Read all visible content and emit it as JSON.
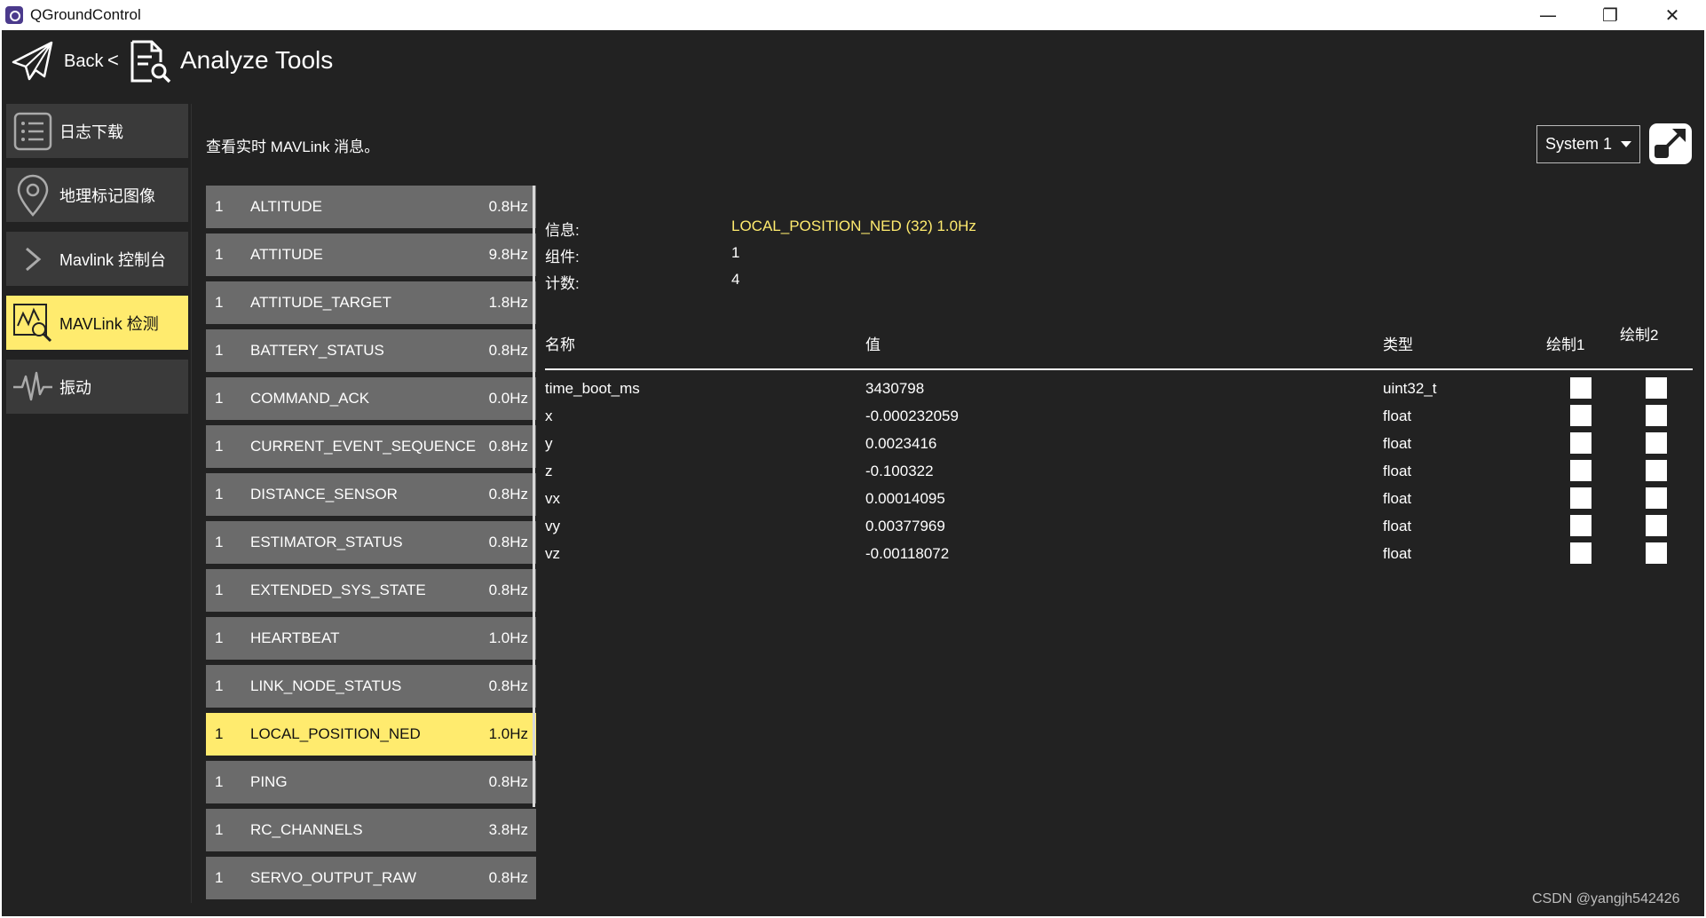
{
  "window": {
    "title": "QGroundControl",
    "minimize_glyph": "—",
    "maximize_glyph": "❐",
    "close_glyph": "✕"
  },
  "header": {
    "back_label": "Back",
    "separator": "<",
    "page_title": "Analyze Tools"
  },
  "sidebar": {
    "items": [
      {
        "label": "日志下载",
        "icon": "list-icon"
      },
      {
        "label": "地理标记图像",
        "icon": "map-pin-icon"
      },
      {
        "label": "Mavlink 控制台",
        "icon": "chevron-right-icon"
      },
      {
        "label": "MAVLink 检测",
        "icon": "chart-search-icon",
        "active": true
      },
      {
        "label": "振动",
        "icon": "waveform-icon"
      }
    ]
  },
  "description": "查看实时 MAVLink 消息。",
  "system_select": {
    "selected": "System 1"
  },
  "messages": [
    {
      "comp": "1",
      "name": "ALTITUDE",
      "rate": "0.8Hz"
    },
    {
      "comp": "1",
      "name": "ATTITUDE",
      "rate": "9.8Hz"
    },
    {
      "comp": "1",
      "name": "ATTITUDE_TARGET",
      "rate": "1.8Hz"
    },
    {
      "comp": "1",
      "name": "BATTERY_STATUS",
      "rate": "0.8Hz"
    },
    {
      "comp": "1",
      "name": "COMMAND_ACK",
      "rate": "0.0Hz"
    },
    {
      "comp": "1",
      "name": "CURRENT_EVENT_SEQUENCE",
      "rate": "0.8Hz"
    },
    {
      "comp": "1",
      "name": "DISTANCE_SENSOR",
      "rate": "0.8Hz"
    },
    {
      "comp": "1",
      "name": "ESTIMATOR_STATUS",
      "rate": "0.8Hz"
    },
    {
      "comp": "1",
      "name": "EXTENDED_SYS_STATE",
      "rate": "0.8Hz"
    },
    {
      "comp": "1",
      "name": "HEARTBEAT",
      "rate": "1.0Hz"
    },
    {
      "comp": "1",
      "name": "LINK_NODE_STATUS",
      "rate": "0.8Hz"
    },
    {
      "comp": "1",
      "name": "LOCAL_POSITION_NED",
      "rate": "1.0Hz",
      "selected": true
    },
    {
      "comp": "1",
      "name": "PING",
      "rate": "0.8Hz"
    },
    {
      "comp": "1",
      "name": "RC_CHANNELS",
      "rate": "3.8Hz"
    },
    {
      "comp": "1",
      "name": "SERVO_OUTPUT_RAW",
      "rate": "0.8Hz"
    }
  ],
  "detail": {
    "info_label": "信息:",
    "info_value": "LOCAL_POSITION_NED (32) 1.0Hz",
    "component_label": "组件:",
    "component_value": "1",
    "count_label": "计数:",
    "count_value": "4",
    "columns": {
      "name": "名称",
      "value": "值",
      "type": "类型",
      "plot1": "绘制1",
      "plot2": "绘制2"
    },
    "fields": [
      {
        "name": "time_boot_ms",
        "value": "3430798",
        "type": "uint32_t"
      },
      {
        "name": "x",
        "value": "-0.000232059",
        "type": "float"
      },
      {
        "name": "y",
        "value": "0.0023416",
        "type": "float"
      },
      {
        "name": "z",
        "value": "-0.100322",
        "type": "float"
      },
      {
        "name": "vx",
        "value": "0.00014095",
        "type": "float"
      },
      {
        "name": "vy",
        "value": "0.00377969",
        "type": "float"
      },
      {
        "name": "vz",
        "value": "-0.00118072",
        "type": "float"
      }
    ]
  },
  "watermark": "CSDN @yangjh542426",
  "colors": {
    "accent": "#ffeb6e",
    "background": "#222222",
    "item": "#6b6b6b"
  }
}
